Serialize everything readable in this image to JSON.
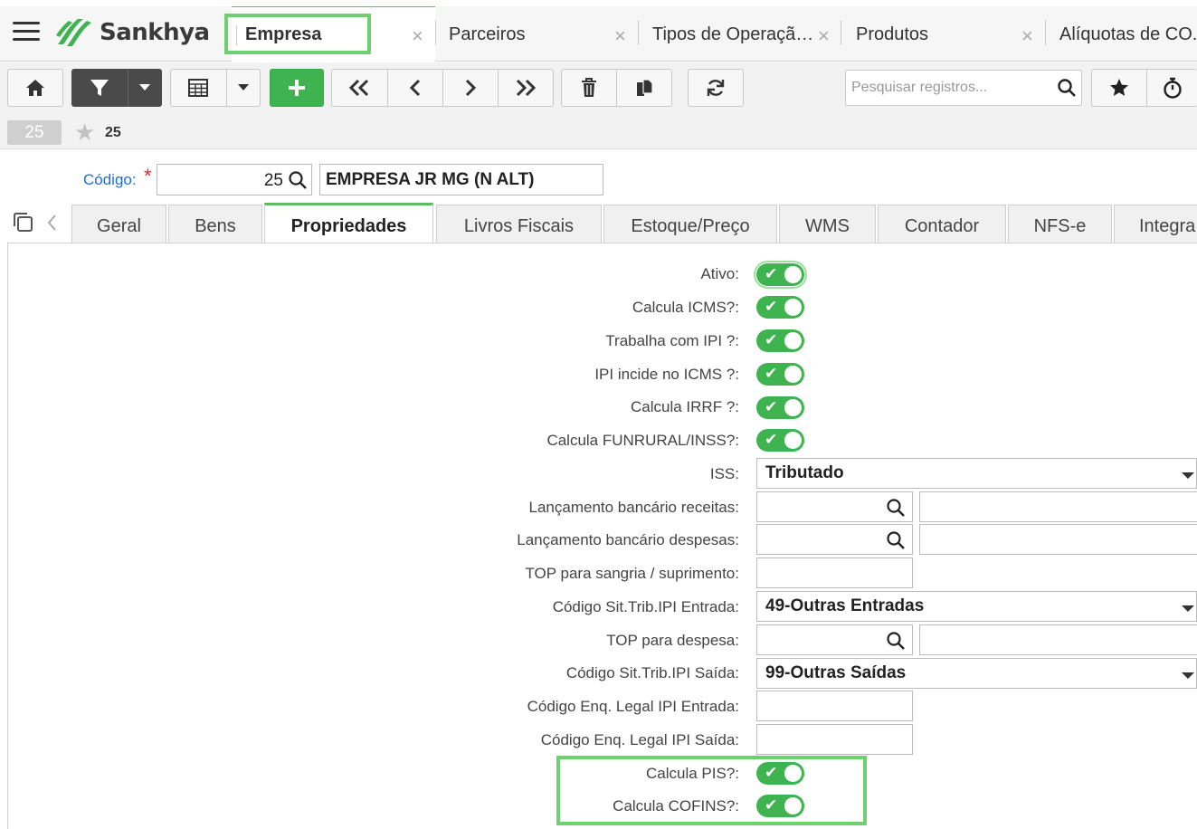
{
  "app": {
    "brand": "Sankhya",
    "brand_color": "#3fb34f"
  },
  "app_tabs": [
    {
      "label": "Empresa",
      "active": true
    },
    {
      "label": "Parceiros"
    },
    {
      "label": "Tipos de Operaçã…"
    },
    {
      "label": "Produtos"
    },
    {
      "label": "Alíquotas de CO."
    }
  ],
  "toolbar": {
    "search_placeholder": "Pesquisar registros...",
    "icons": [
      "home-icon",
      "filter-icon",
      "grid-icon",
      "add-icon",
      "first-icon",
      "prev-icon",
      "next-icon",
      "last-icon",
      "delete-icon",
      "copy-icon",
      "refresh-icon",
      "star-icon",
      "timer-icon"
    ]
  },
  "record": {
    "badge": "25",
    "number": "25"
  },
  "header": {
    "codigo_label": "Código:",
    "codigo_value": "25",
    "empresa_name": "EMPRESA JR MG (N ALT)"
  },
  "inner_tabs": [
    {
      "label": "Geral"
    },
    {
      "label": "Bens"
    },
    {
      "label": "Propriedades",
      "active": true
    },
    {
      "label": "Livros Fiscais"
    },
    {
      "label": "Estoque/Preço"
    },
    {
      "label": "WMS"
    },
    {
      "label": "Contador"
    },
    {
      "label": "NFS-e"
    },
    {
      "label": "Integra"
    }
  ],
  "form": {
    "ativo": {
      "label": "Ativo:",
      "checked": true
    },
    "calcula_icms": {
      "label": "Calcula ICMS?:",
      "checked": true
    },
    "trabalha_ipi": {
      "label": "Trabalha com IPI ?:",
      "checked": true
    },
    "ipi_incide_icms": {
      "label": "IPI incide no ICMS ?:",
      "checked": true
    },
    "calcula_irrf": {
      "label": "Calcula IRRF ?:",
      "checked": true
    },
    "calcula_funrural": {
      "label": "Calcula FUNRURAL/INSS?:",
      "checked": true
    },
    "iss": {
      "label": "ISS:",
      "value": "Tributado"
    },
    "lanc_receitas": {
      "label": "Lançamento bancário receitas:"
    },
    "lanc_despesas": {
      "label": "Lançamento bancário despesas:"
    },
    "top_sangria": {
      "label": "TOP para sangria / suprimento:"
    },
    "cst_ipi_entrada": {
      "label": "Código Sit.Trib.IPI Entrada:",
      "value": "49-Outras Entradas"
    },
    "top_despesa": {
      "label": "TOP para despesa:"
    },
    "cst_ipi_saida": {
      "label": "Código Sit.Trib.IPI Saída:",
      "value": "99-Outras Saídas"
    },
    "enq_ipi_entrada": {
      "label": "Código Enq. Legal IPI Entrada:"
    },
    "enq_ipi_saida": {
      "label": "Código Enq. Legal IPI Saída:"
    },
    "calcula_pis": {
      "label": "Calcula PIS?:",
      "checked": true
    },
    "calcula_cofins": {
      "label": "Calcula COFINS?:",
      "checked": true
    }
  }
}
